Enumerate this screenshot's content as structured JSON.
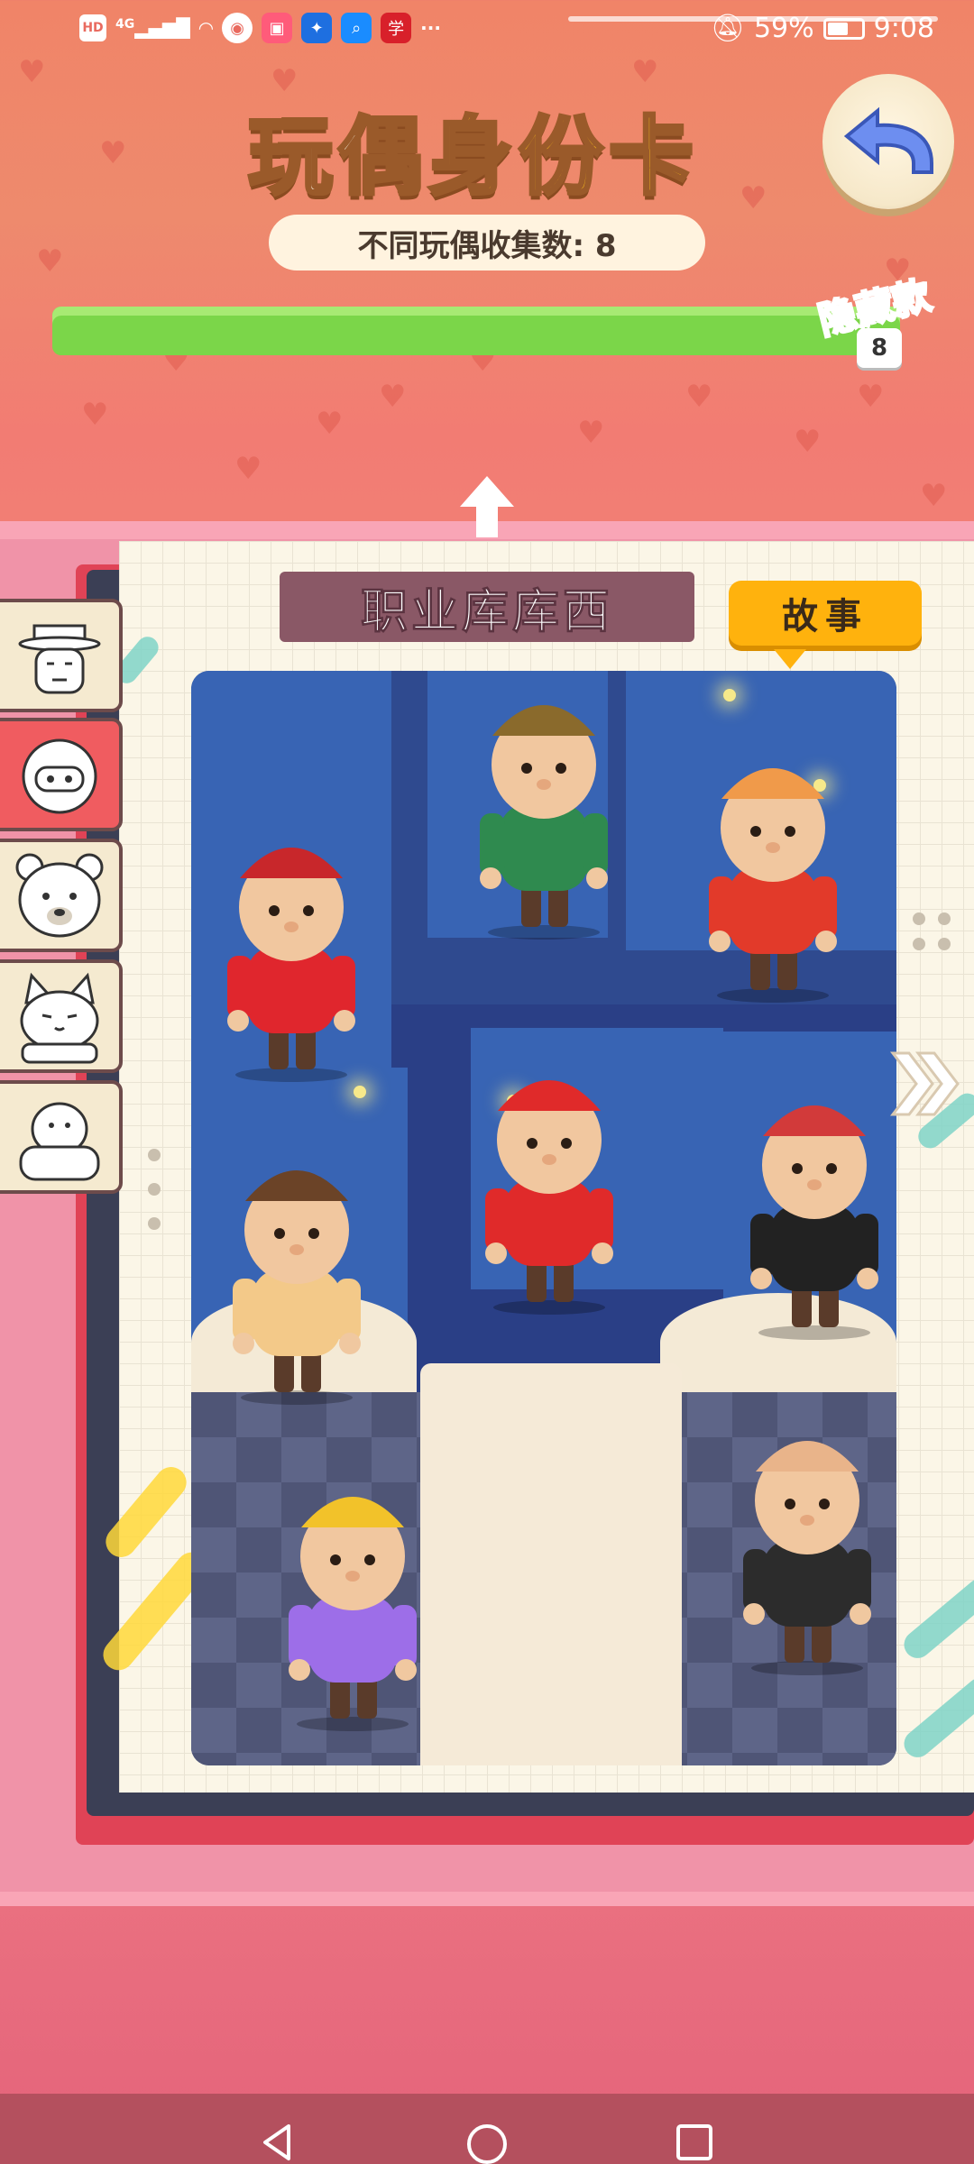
{
  "status_bar": {
    "hd": "HD",
    "signal": "4G",
    "battery_percent": "59%",
    "time": "9:08",
    "more": "···"
  },
  "header": {
    "title_part1": "玩偶",
    "title_part2": "身份卡",
    "collect_label": "不同玩偶收集数: 8",
    "progress_fraction": 1.0,
    "hidden_tag": "隐藏款",
    "count_badge": "8"
  },
  "card": {
    "name": "职业库库西",
    "story_button": "故事"
  },
  "side_tabs": [
    {
      "name": "tab-old-man",
      "active": false
    },
    {
      "name": "tab-helmet-doll",
      "active": true
    },
    {
      "name": "tab-bear",
      "active": false
    },
    {
      "name": "tab-cat",
      "active": false
    },
    {
      "name": "tab-seal",
      "active": false
    }
  ],
  "figures": [
    {
      "id": "bellhop-figure",
      "hat": "#c8272b",
      "body": "#e0262d"
    },
    {
      "id": "tophat-figure",
      "hat": "#8a6a2c",
      "body": "#2f8a4f"
    },
    {
      "id": "racer-figure",
      "hat": "#f09a4a",
      "body": "#e23a2a"
    },
    {
      "id": "gentleman-figure",
      "hat": "#6b4327",
      "body": "#f3c989"
    },
    {
      "id": "santa-figure",
      "hat": "#e02a2a",
      "body": "#e02a2a"
    },
    {
      "id": "punk-figure",
      "hat": "#d23a3a",
      "body": "#222222"
    },
    {
      "id": "worker-figure",
      "hat": "#f2c22a",
      "body": "#9d6ee8"
    },
    {
      "id": "businessman-figure",
      "hat": "#e9b48a",
      "body": "#2c2c2c"
    }
  ],
  "colors": {
    "accent": "#ffb20d",
    "progress": "#7bd649",
    "banner": "#8a5866",
    "active_tab": "#f05c60"
  }
}
